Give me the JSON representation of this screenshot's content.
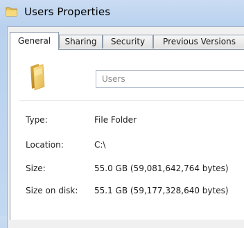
{
  "window": {
    "title": "Users Properties",
    "title_icon": "folder-icon"
  },
  "tabs": [
    {
      "label": "General",
      "active": true
    },
    {
      "label": "Sharing",
      "active": false
    },
    {
      "label": "Security",
      "active": false
    },
    {
      "label": "Previous Versions",
      "active": false
    }
  ],
  "general": {
    "folder_icon": "folder-icon",
    "name_value": "Users",
    "properties": [
      {
        "label": "Type:",
        "value": "File Folder"
      },
      {
        "label": "Location:",
        "value": "C:\\"
      },
      {
        "label": "Size:",
        "value": "55.0 GB (59,081,642,764 bytes)"
      },
      {
        "label": "Size on disk:",
        "value": "55.1 GB (59,177,328,640 bytes)"
      }
    ]
  },
  "colors": {
    "title_bar": "#c3d8f1",
    "panel": "#ffffff",
    "folder_yellow": "#f2d36b"
  }
}
